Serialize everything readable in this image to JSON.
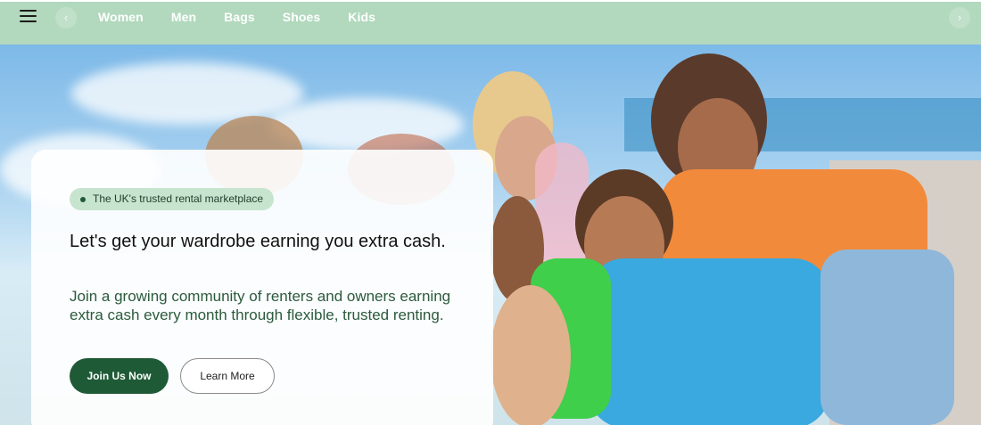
{
  "nav": {
    "menu_icon": "hamburger-icon",
    "prev_icon": "chevron-left-icon",
    "next_icon": "chevron-right-icon",
    "prev_glyph": "‹",
    "next_glyph": "›",
    "categories": [
      "Women",
      "Men",
      "Bags",
      "Shoes",
      "Kids"
    ]
  },
  "hero": {
    "badge": "The UK's trusted rental marketplace",
    "headline": "Let's get your wardrobe earning you extra cash.",
    "subtext": "Join a growing community of renters and owners earning extra cash every month through flexible, trusted renting.",
    "primary_cta": "Join Us Now",
    "secondary_cta": "Learn More"
  },
  "colors": {
    "nav_bg": "#b2d9bd",
    "primary": "#1f5a36",
    "badge_bg": "#c7e4cf",
    "subtext": "#2c5a3c"
  }
}
